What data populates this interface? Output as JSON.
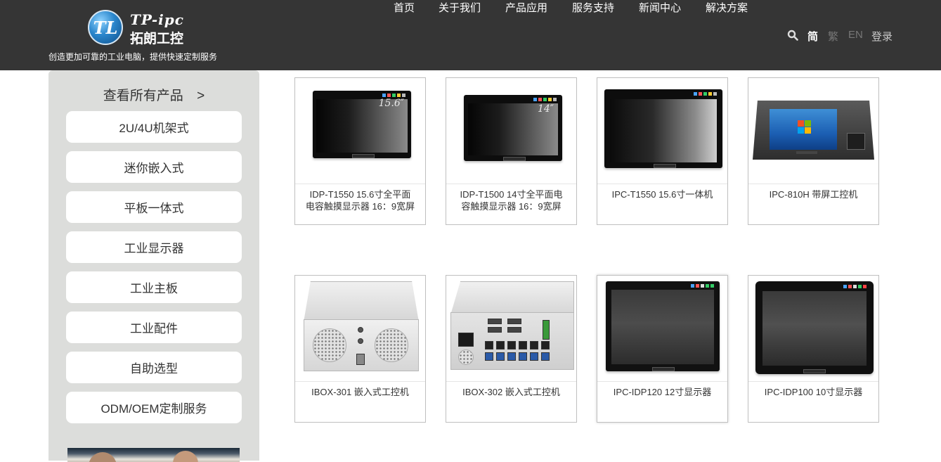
{
  "header": {
    "logo": {
      "en": "TP-ipc",
      "cn": "拓朗工控",
      "mark": "TL"
    },
    "slogan": "创造更加可靠的工业电脑，提供快速定制服务",
    "nav": [
      "首页",
      "关于我们",
      "产品应用",
      "服务支持",
      "新闻中心",
      "解决方案"
    ],
    "lang": {
      "simplified": "简",
      "traditional": "繁",
      "english": "EN"
    },
    "login": "登录"
  },
  "sidebar": {
    "title": "查看所有产品",
    "title_arrow": ">",
    "categories": [
      "2U/4U机架式",
      "迷你嵌入式",
      "平板一体式",
      "工业显示器",
      "工业主板",
      "工业配件",
      "自助选型",
      "ODM/OEM定制服务"
    ]
  },
  "products": [
    {
      "line1": "IDP-T1550 15.6寸全平面",
      "line2": "电容触摸显示器 16：9宽屏",
      "screen_label": "15.6″"
    },
    {
      "line1": "IDP-T1500 14寸全平面电",
      "line2": "容触摸显示器 16：9宽屏",
      "screen_label": "14″"
    },
    {
      "line1": "IPC-T1550 15.6寸一体机",
      "line2": ""
    },
    {
      "line1": "IPC-810H 带屏工控机",
      "line2": ""
    },
    {
      "line1": "IBOX-301 嵌入式工控机",
      "line2": ""
    },
    {
      "line1": "IBOX-302 嵌入式工控机",
      "line2": ""
    },
    {
      "line1": "IPC-IDP120 12寸显示器",
      "line2": ""
    },
    {
      "line1": "IPC-IDP100 10寸显示器",
      "line2": ""
    }
  ],
  "colors": {
    "header_bg": "#353535",
    "sidebar_bg": "#dcdddb",
    "card_border": "#bfbfbf"
  }
}
